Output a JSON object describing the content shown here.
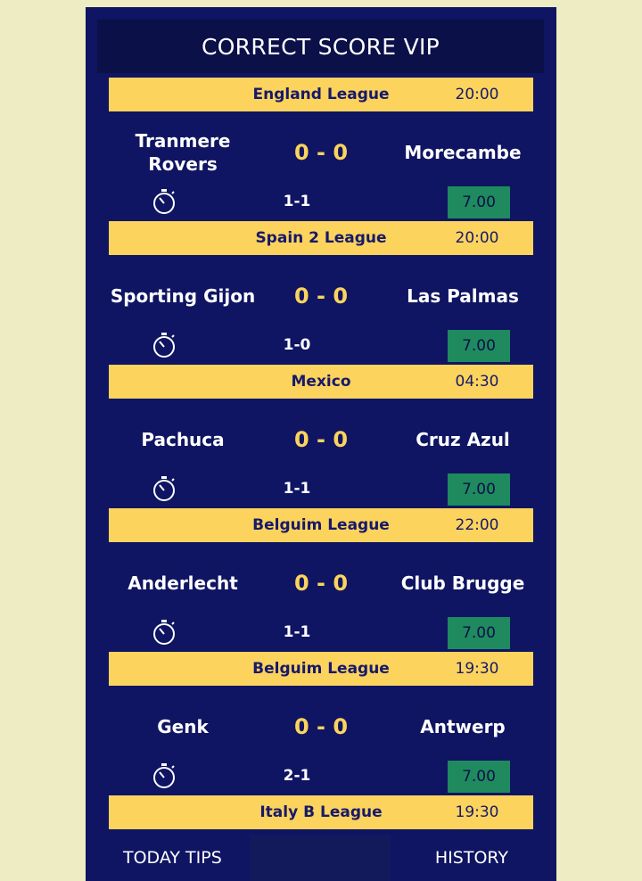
{
  "header": {
    "title": "CORRECT SCORE VIP"
  },
  "matches": [
    {
      "league": "England League",
      "time": "20:00",
      "home": "Tranmere Rovers",
      "away": "Morecambe",
      "score": "0 - 0",
      "tip": "1-1",
      "odds": "7.00"
    },
    {
      "league": "Spain 2 League",
      "time": "20:00",
      "home": "Sporting Gijon",
      "away": "Las Palmas",
      "score": "0 - 0",
      "tip": "1-0",
      "odds": "7.00"
    },
    {
      "league": "Mexico",
      "time": "04:30",
      "home": "Pachuca",
      "away": "Cruz Azul",
      "score": "0 - 0",
      "tip": "1-1",
      "odds": "7.00"
    },
    {
      "league": "Belguim League",
      "time": "22:00",
      "home": "Anderlecht",
      "away": "Club Brugge",
      "score": "0 - 0",
      "tip": "1-1",
      "odds": "7.00"
    },
    {
      "league": "Belguim League",
      "time": "19:30",
      "home": "Genk",
      "away": "Antwerp",
      "score": "0 - 0",
      "tip": "2-1",
      "odds": "7.00"
    }
  ],
  "partial": {
    "league": "Italy B League",
    "time": "19:30"
  },
  "nav": {
    "today": "TODAY TIPS",
    "history": "HISTORY"
  },
  "colors": {
    "background": "#0f1562",
    "accent": "#fbd35d",
    "odds": "#1e8a5e",
    "page": "#eeecc2"
  },
  "icons": {
    "clock": "stopwatch-icon"
  }
}
